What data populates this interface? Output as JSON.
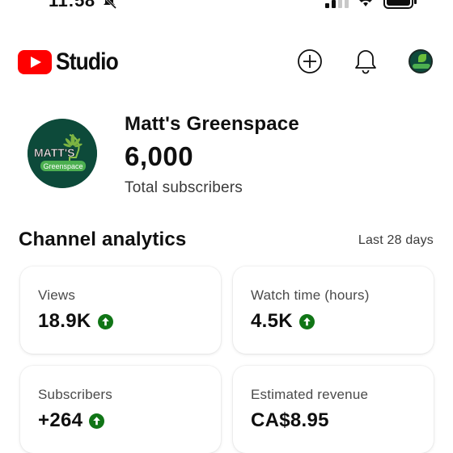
{
  "status_bar": {
    "time": "11:58"
  },
  "header": {
    "logo_text": "Studio",
    "brand_color": "#ff0000",
    "icons": [
      "youtube-logo-icon",
      "create-icon",
      "bell-icon",
      "account-avatar"
    ]
  },
  "channel": {
    "name": "Matt's Greenspace",
    "subscribers": "6,000",
    "subscribers_label": "Total subscribers",
    "avatar_text_top": "MATT'S",
    "avatar_text_band": "Greenspace"
  },
  "analytics": {
    "title": "Channel analytics",
    "range": "Last 28 days",
    "up_color": "#107516",
    "cards": [
      {
        "label": "Views",
        "value": "18.9K",
        "trend": "up"
      },
      {
        "label": "Watch time (hours)",
        "value": "4.5K",
        "trend": "up"
      },
      {
        "label": "Subscribers",
        "value": "+264",
        "trend": "up"
      },
      {
        "label": "Estimated revenue",
        "value": "CA$8.95",
        "trend": ""
      }
    ]
  }
}
